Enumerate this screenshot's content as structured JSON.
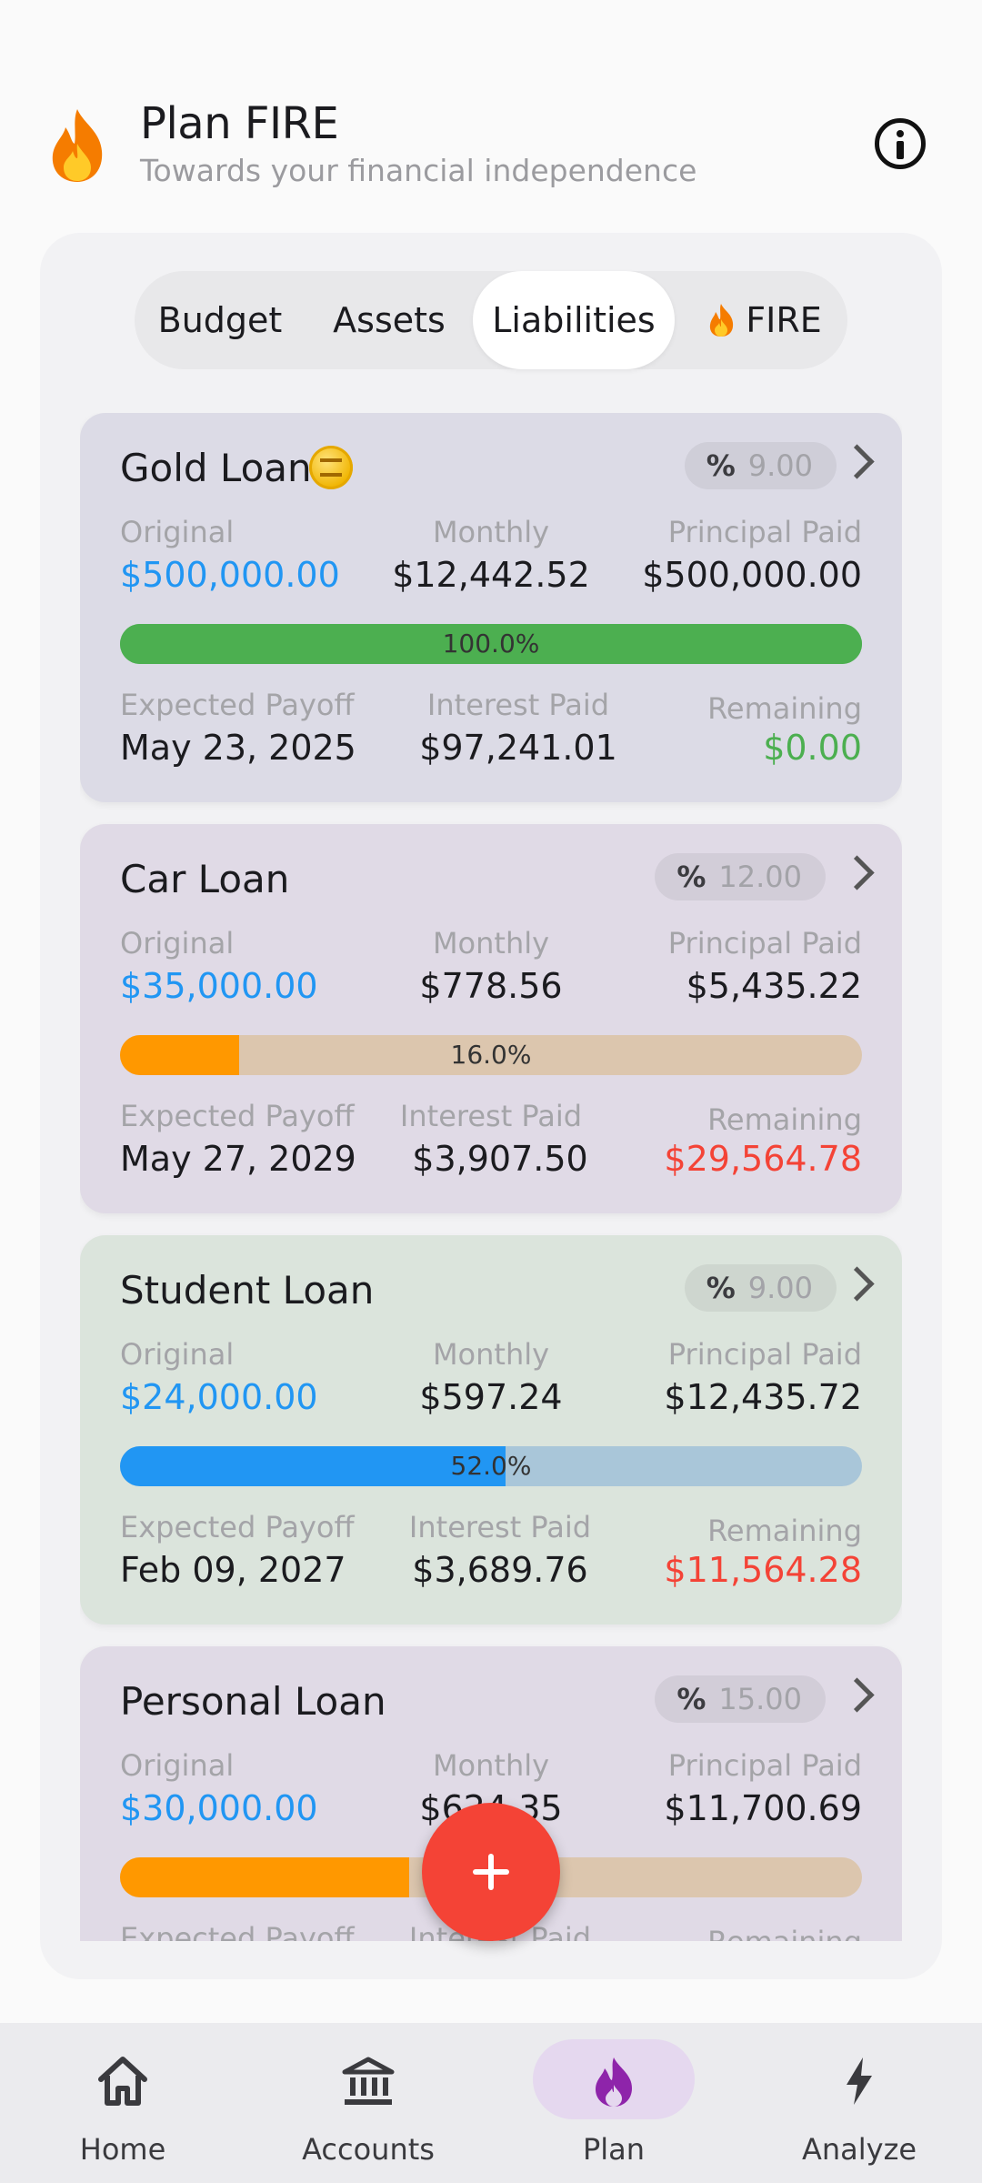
{
  "header": {
    "title": "Plan FIRE",
    "subtitle": "Towards your financial independence"
  },
  "tabs": [
    {
      "label": "Budget"
    },
    {
      "label": "Assets"
    },
    {
      "label": "Liabilities",
      "active": true
    },
    {
      "label": "FIRE",
      "icon": "flame-icon"
    }
  ],
  "labels": {
    "original": "Original",
    "monthly": "Monthly",
    "principal_paid": "Principal Paid",
    "expected_payoff": "Expected Payoff",
    "interest_paid": "Interest Paid",
    "remaining": "Remaining",
    "pct_symbol": "%"
  },
  "loans": [
    {
      "name": "Gold Loan",
      "icon": "coin-icon",
      "rate": "9.00",
      "original": "$500,000.00",
      "monthly": "$12,442.52",
      "principal_paid": "$500,000.00",
      "progress_text": "100.0%",
      "progress": 1.0,
      "expected_payoff": "May 23, 2025",
      "interest_paid": "$97,241.01",
      "remaining": "$0.00",
      "remaining_color": "#4caf50",
      "bar_color": "#4caf50",
      "track_color": "#4caf50",
      "card_bg": "#dcdbe6"
    },
    {
      "name": "Car Loan",
      "rate": "12.00",
      "original": "$35,000.00",
      "monthly": "$778.56",
      "principal_paid": "$5,435.22",
      "progress_text": "16.0%",
      "progress": 0.16,
      "expected_payoff": "May 27, 2029",
      "interest_paid": "$3,907.50",
      "remaining": "$29,564.78",
      "remaining_color": "#f44336",
      "bar_color": "#ff9800",
      "track_color": "#dcc6ae",
      "card_bg": "#e0dae6"
    },
    {
      "name": "Student Loan",
      "rate": "9.00",
      "original": "$24,000.00",
      "monthly": "$597.24",
      "principal_paid": "$12,435.72",
      "progress_text": "52.0%",
      "progress": 0.52,
      "expected_payoff": "Feb 09, 2027",
      "interest_paid": "$3,689.76",
      "remaining": "$11,564.28",
      "remaining_color": "#f44336",
      "bar_color": "#2196f3",
      "track_color": "#a9c6d9",
      "card_bg": "#dbe4dc"
    },
    {
      "name": "Personal Loan",
      "rate": "15.00",
      "original": "$30,000.00",
      "monthly": "$624.35",
      "principal_paid": "$11,700.69",
      "progress_text": "39.0%",
      "progress": 0.39,
      "expected_payoff": "",
      "interest_paid": "",
      "remaining": "",
      "remaining_color": "#f44336",
      "bar_color": "#ff9800",
      "track_color": "#dcc6ae",
      "card_bg": "#e0dae6"
    }
  ],
  "nav": [
    {
      "label": "Home",
      "icon": "home-icon"
    },
    {
      "label": "Accounts",
      "icon": "bank-icon"
    },
    {
      "label": "Plan",
      "icon": "flame-icon",
      "active": true
    },
    {
      "label": "Analyze",
      "icon": "bolt-icon"
    }
  ],
  "colors": {
    "accent": "#f44336",
    "blue": "#2196f3",
    "green": "#4caf50",
    "red": "#f44336",
    "nav_active": "#e5d8ef"
  }
}
